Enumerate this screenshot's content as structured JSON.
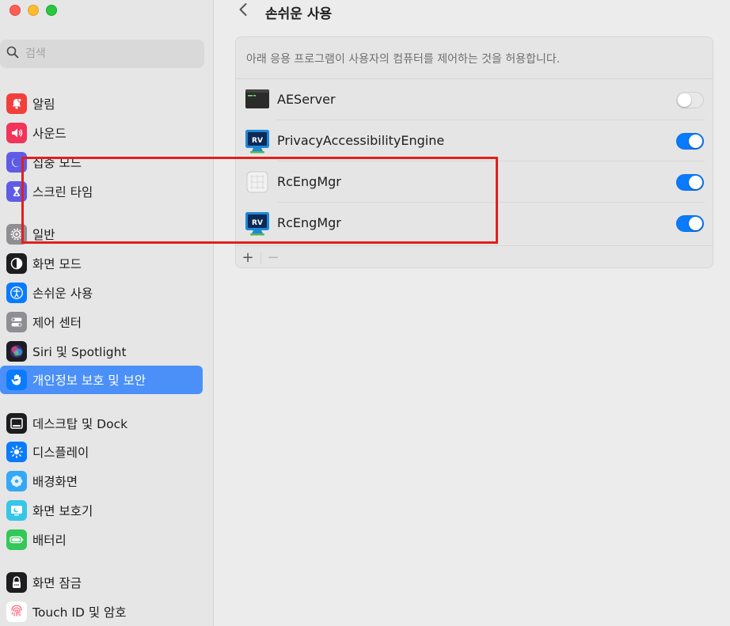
{
  "window": {
    "title": "손쉬운 사용"
  },
  "search": {
    "placeholder": "검색"
  },
  "sidebar": {
    "items": [
      {
        "label": "알림",
        "icon": "bell-icon",
        "color": "#f23f3b"
      },
      {
        "label": "사운드",
        "icon": "speaker-icon",
        "color": "#f2335a"
      },
      {
        "label": "집중 모드",
        "icon": "moon-icon",
        "color": "#5e5ce6"
      },
      {
        "label": "스크린 타임",
        "icon": "hourglass-icon",
        "color": "#5e5ce6"
      },
      {
        "label": "일반",
        "icon": "gear-icon",
        "color": "#8e8e93"
      },
      {
        "label": "화면 모드",
        "icon": "appearance-icon",
        "color": "#1d1d1f"
      },
      {
        "label": "손쉬운 사용",
        "icon": "accessibility-icon",
        "color": "#0a7bfc"
      },
      {
        "label": "제어 센터",
        "icon": "control-center-icon",
        "color": "#8e8e93"
      },
      {
        "label": "Siri 및 Spotlight",
        "icon": "siri-icon",
        "color": "#1d1d1f"
      },
      {
        "label": "개인정보 보호 및 보안",
        "icon": "hand-icon",
        "color": "#0a7bfc",
        "selected": true
      },
      {
        "label": "데스크탑 및 Dock",
        "icon": "dock-icon",
        "color": "#1d1d1f"
      },
      {
        "label": "디스플레이",
        "icon": "sun-icon",
        "color": "#0a7bfc"
      },
      {
        "label": "배경화면",
        "icon": "flower-icon",
        "color": "#35a8f5"
      },
      {
        "label": "화면 보호기",
        "icon": "screensaver-icon",
        "color": "#35c6e8"
      },
      {
        "label": "배터리",
        "icon": "battery-icon",
        "color": "#34c759"
      },
      {
        "label": "화면 잠금",
        "icon": "lock-icon",
        "color": "#1d1d1f"
      },
      {
        "label": "Touch ID 및 암호",
        "icon": "fingerprint-icon",
        "color": "#ff6b7f"
      }
    ]
  },
  "main": {
    "description": "아래 응용 프로그램이 사용자의 컴퓨터를 제어하는 것을 허용합니다.",
    "apps": [
      {
        "name": "AEServer",
        "icon": "terminal-app-icon",
        "enabled": false
      },
      {
        "name": "PrivacyAccessibilityEngine",
        "icon": "rv-monitor-icon",
        "enabled": true
      },
      {
        "name": "RcEngMgr",
        "icon": "blank-app-icon",
        "enabled": true
      },
      {
        "name": "RcEngMgr",
        "icon": "rv-monitor-icon",
        "enabled": true
      }
    ],
    "add_label": "+",
    "remove_label": "−"
  },
  "colors": {
    "accent": "#0a7bfc",
    "highlight": "#e0201f",
    "selection": "#4a90f8"
  }
}
